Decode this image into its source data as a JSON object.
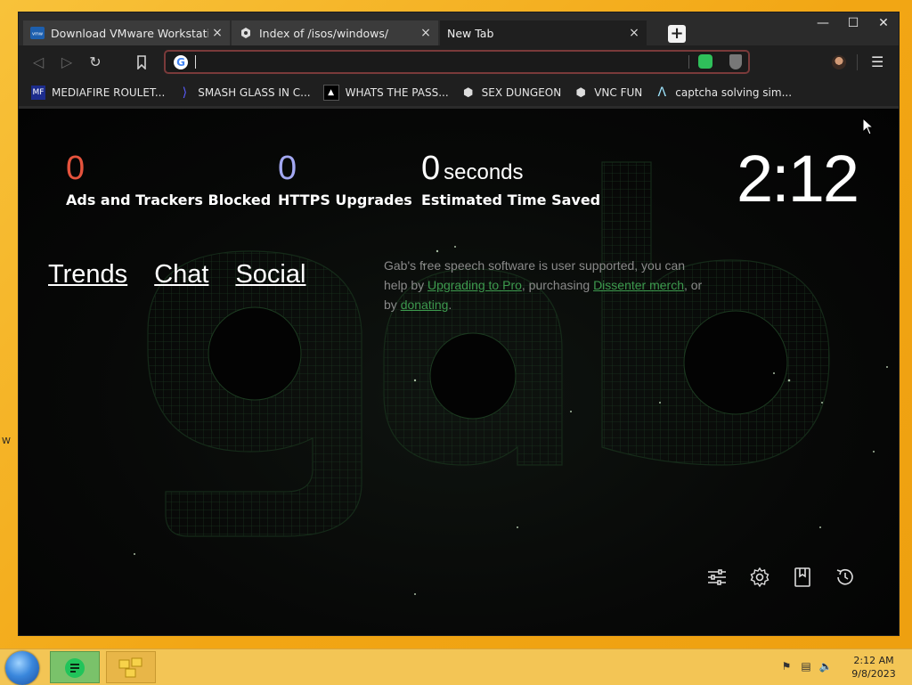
{
  "window": {
    "tabs": [
      {
        "title": "Download VMware Workstation Pl",
        "favicon": "vmware-icon",
        "active": false
      },
      {
        "title": "Index of /isos/windows/",
        "favicon": "ghost-icon",
        "active": false
      },
      {
        "title": "New Tab",
        "favicon": "",
        "active": true
      }
    ],
    "newtab_label": "+",
    "minimize": "—",
    "maximize": "☐",
    "close": "✕"
  },
  "toolbar": {
    "address_value": "",
    "back": "◁",
    "forward": "▷",
    "reload": "↻",
    "bookmark": "🔖",
    "menu": "☰"
  },
  "bookmarks": [
    {
      "label": "MEDIAFIRE ROULET...",
      "icon": "mediafire-icon"
    },
    {
      "label": "SMASH GLASS IN C...",
      "icon": "bolt-icon"
    },
    {
      "label": "WHATS THE PASS...",
      "icon": "terminal-icon"
    },
    {
      "label": "SEX DUNGEON",
      "icon": "ghost-icon"
    },
    {
      "label": "VNC FUN",
      "icon": "ghost-icon"
    },
    {
      "label": "captcha solving sim...",
      "icon": "arrow-icon"
    }
  ],
  "stats": {
    "ads": {
      "value": "0",
      "label": "Ads and Trackers Blocked",
      "color": "#e5533d"
    },
    "https": {
      "value": "0",
      "label": "HTTPS Upgrades",
      "color": "#a3a8f2"
    },
    "time": {
      "value": "0",
      "unit": "seconds",
      "label": "Estimated Time Saved",
      "color": "#ffffff"
    }
  },
  "clock": "2:12",
  "links": [
    "Trends",
    "Chat",
    "Social"
  ],
  "blurb": {
    "p1": "Gab's free speech software is user supported, you can help by ",
    "link1": "Upgrading to Pro",
    "p2": ", purchasing ",
    "link2": "Dissenter merch",
    "p3": ", or by ",
    "link3": "donating",
    "p4": "."
  },
  "taskbar": {
    "time": "2:12 AM",
    "date": "9/8/2023",
    "apps": [
      "dissenter-icon",
      "folder-icon"
    ]
  },
  "colors": {
    "accent_green": "#3d9a4e",
    "urlbar_border": "#7a3a3a"
  }
}
